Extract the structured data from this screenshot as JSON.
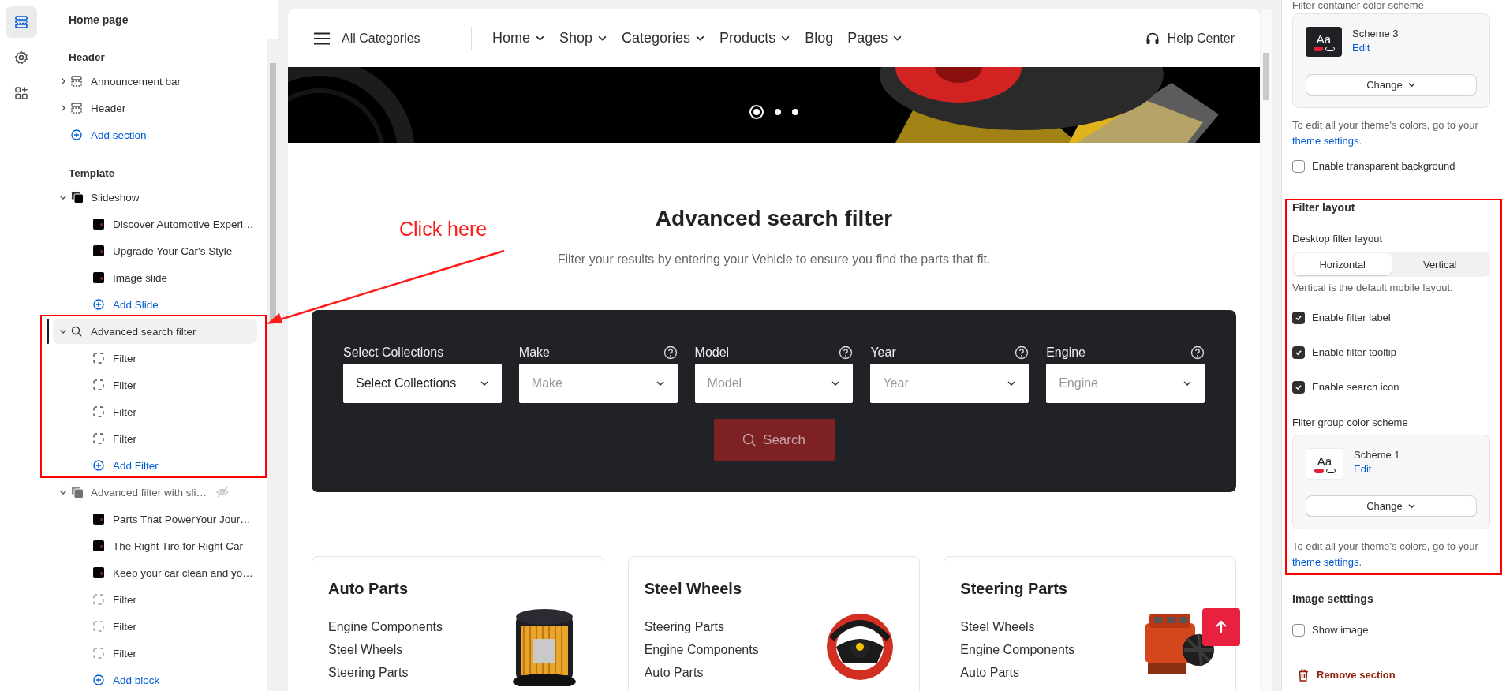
{
  "rail": {
    "items": [
      {
        "kind": "sections",
        "selected": true
      },
      {
        "kind": "settings",
        "selected": false
      },
      {
        "kind": "apps",
        "selected": false
      }
    ]
  },
  "tree": {
    "title": "Home page",
    "groups": [
      {
        "label": "Header",
        "items": [
          {
            "kind": "header-section",
            "label": "Announcement bar",
            "expanded": false,
            "selected": false,
            "hidden": false
          },
          {
            "kind": "header-section",
            "label": "Header",
            "expanded": false,
            "selected": false,
            "hidden": false
          },
          {
            "kind": "add",
            "label": "Add section"
          }
        ]
      },
      {
        "label": "Template",
        "items": [
          {
            "kind": "slideshow",
            "label": "Slideshow",
            "expanded": true,
            "selected": false,
            "hidden": false,
            "children": [
              {
                "kind": "slide",
                "label": "Discover Automotive Experi…"
              },
              {
                "kind": "slide",
                "label": "Upgrade Your Car's Style"
              },
              {
                "kind": "slide",
                "label": "Image slide"
              },
              {
                "kind": "add",
                "label": "Add Slide"
              }
            ]
          },
          {
            "kind": "search-section",
            "label": "Advanced search filter",
            "expanded": true,
            "selected": true,
            "hidden": false,
            "children": [
              {
                "kind": "filter",
                "label": "Filter"
              },
              {
                "kind": "filter",
                "label": "Filter"
              },
              {
                "kind": "filter",
                "label": "Filter"
              },
              {
                "kind": "filter",
                "label": "Filter"
              },
              {
                "kind": "add",
                "label": "Add Filter"
              }
            ]
          },
          {
            "kind": "slider-section",
            "label": "Advanced filter with sli…",
            "expanded": true,
            "selected": false,
            "hidden": true,
            "children": [
              {
                "kind": "slide",
                "label": "Parts That PowerYour Jour…"
              },
              {
                "kind": "slide",
                "label": "The Right Tire for Right Car"
              },
              {
                "kind": "slide",
                "label": "Keep your car clean and yo…"
              },
              {
                "kind": "filter",
                "label": "Filter"
              },
              {
                "kind": "filter",
                "label": "Filter"
              },
              {
                "kind": "filter",
                "label": "Filter"
              },
              {
                "kind": "add",
                "label": "Add block"
              }
            ]
          }
        ]
      }
    ]
  },
  "store_nav": {
    "categories_label": "All Categories",
    "links": [
      {
        "label": "Home",
        "dropdown": true
      },
      {
        "label": "Shop",
        "dropdown": true
      },
      {
        "label": "Categories",
        "dropdown": true
      },
      {
        "label": "Products",
        "dropdown": true
      },
      {
        "label": "Blog",
        "dropdown": false
      },
      {
        "label": "Pages",
        "dropdown": true
      }
    ],
    "help": "Help Center"
  },
  "banner": {
    "dots": [
      {
        "selected": true
      },
      {
        "selected": false
      },
      {
        "selected": false
      }
    ]
  },
  "search_section": {
    "title": "Advanced search filter",
    "subtitle": "Filter your results by entering your Vehicle to ensure you find the parts that fit.",
    "filters": [
      {
        "label": "Select Collections",
        "value": "Select Collections",
        "tooltip": false
      },
      {
        "label": "Make",
        "placeholder": "Make",
        "tooltip": true
      },
      {
        "label": "Model",
        "placeholder": "Model",
        "tooltip": true
      },
      {
        "label": "Year",
        "placeholder": "Year",
        "tooltip": true
      },
      {
        "label": "Engine",
        "placeholder": "Engine",
        "tooltip": true
      }
    ],
    "search_button": {
      "label": "Search",
      "disabled": true
    }
  },
  "categories": [
    {
      "title": "Auto Parts",
      "kind": "filter",
      "links": [
        "Engine Components",
        "Steel Wheels",
        "Steering Parts"
      ]
    },
    {
      "title": "Steel Wheels",
      "kind": "wheel",
      "links": [
        "Steering Parts",
        "Engine Components",
        "Auto Parts"
      ]
    },
    {
      "title": "Steering Parts",
      "kind": "engine",
      "links": [
        "Steel Wheels",
        "Engine Components",
        "Auto Parts"
      ]
    }
  ],
  "settings": {
    "cut_label": "Filter container color scheme",
    "container_scheme": {
      "swatch_text": "Aa",
      "dark": true,
      "name": "Scheme 3",
      "edit": "Edit",
      "change": "Change"
    },
    "container_help": {
      "text": "To edit all your theme's colors, go to your",
      "link": "theme settings",
      "end": "."
    },
    "transparent": {
      "label": "Enable transparent background",
      "checked": false
    },
    "filter_layout": {
      "title": "Filter layout",
      "layout_label": "Desktop filter layout",
      "options": [
        {
          "label": "Horizontal",
          "selected": true
        },
        {
          "label": "Vertical",
          "selected": false
        }
      ],
      "hint": "Vertical is the default mobile layout.",
      "checkboxes": [
        {
          "label": "Enable filter label",
          "checked": true
        },
        {
          "label": "Enable filter tooltip",
          "checked": true
        },
        {
          "label": "Enable search icon",
          "checked": true
        }
      ],
      "group_label": "Filter group color scheme",
      "group_scheme": {
        "swatch_text": "Aa",
        "dark": false,
        "name": "Scheme 1",
        "edit": "Edit",
        "change": "Change"
      },
      "group_help": {
        "text": "To edit all your theme's colors, go to your",
        "link": "theme settings",
        "end": "."
      }
    },
    "image_settings": {
      "title": "Image setttings",
      "checkboxes": [
        {
          "label": "Show image",
          "checked": false
        }
      ]
    },
    "remove": "Remove section"
  },
  "annotation": {
    "callout": "Click here"
  }
}
